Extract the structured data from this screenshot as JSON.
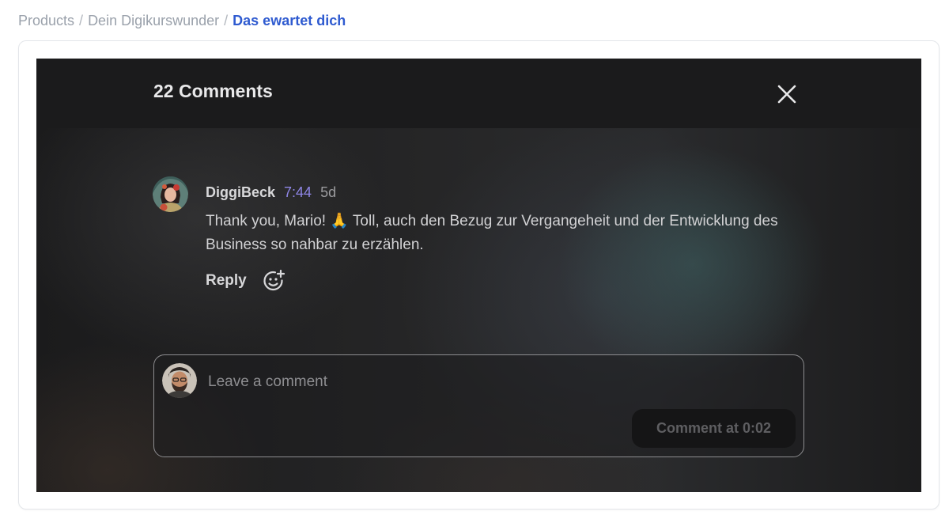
{
  "breadcrumb": {
    "items": [
      "Products",
      "Dein Digikurswunder"
    ],
    "separator": "/",
    "current": "Das ewartet dich"
  },
  "comments_panel": {
    "title": "22 Comments",
    "close_icon": "close-icon"
  },
  "comments": [
    {
      "author": "DiggiBeck",
      "timestamp": "7:44",
      "age": "5d",
      "text": "Thank you, Mario! 🙏 Toll, auch den Bezug zur Vergangeheit und der Entwicklung des Business so nahbar zu erzählen.",
      "reply_label": "Reply",
      "react_icon": "add-reaction-icon"
    }
  ],
  "composer": {
    "placeholder": "Leave a comment",
    "value": "",
    "submit_label": "Comment at 0:02"
  },
  "colors": {
    "breadcrumb_muted": "#9aa1ab",
    "breadcrumb_current": "#2f5bd0",
    "timestamp_accent": "#8f86e6",
    "panel_background": "#1e1e1f"
  }
}
